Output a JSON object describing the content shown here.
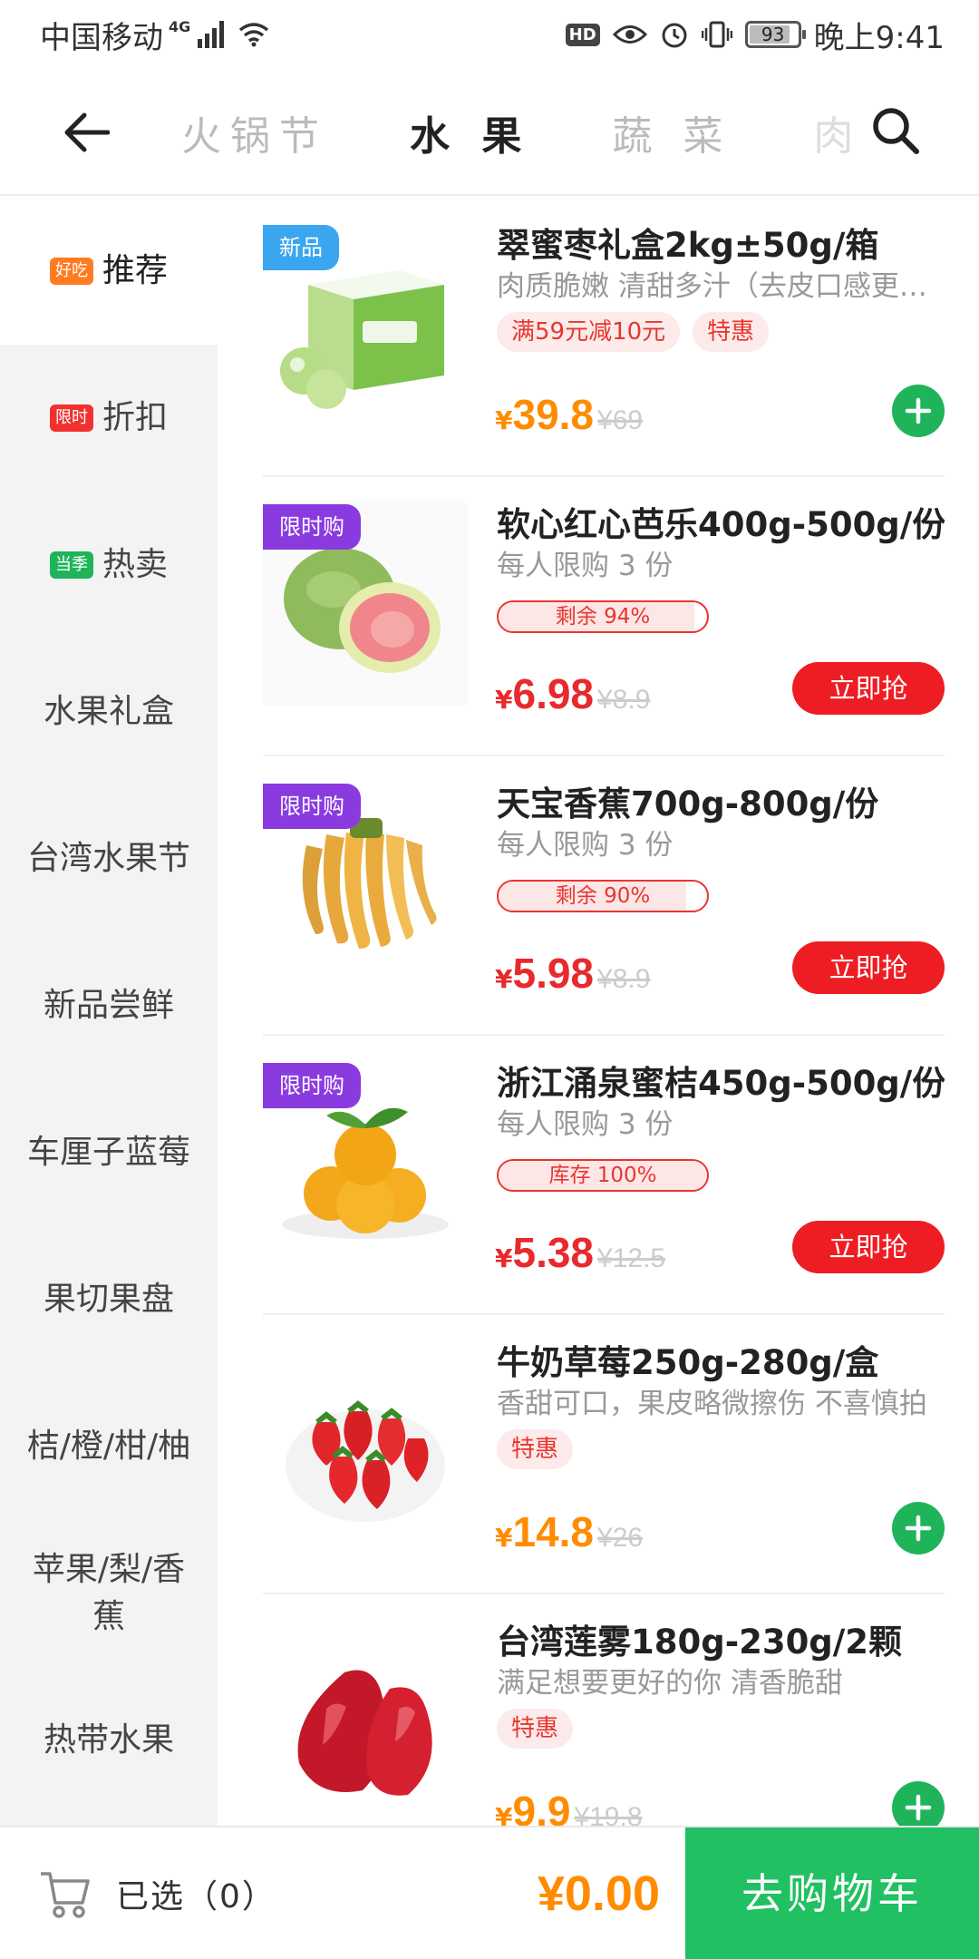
{
  "status_bar": {
    "carrier": "中国移动",
    "network": "4G",
    "battery": "93",
    "time": "晚上9:41"
  },
  "header": {
    "tabs": [
      {
        "label": "火锅节"
      },
      {
        "label": "水 果"
      },
      {
        "label": "蔬 菜"
      },
      {
        "label": "肉"
      }
    ],
    "active_tab": "水 果"
  },
  "sidebar": {
    "items": [
      {
        "tag": "好吃",
        "tag_color": "#ff7a21",
        "label": "推荐",
        "active": true
      },
      {
        "tag": "限时",
        "tag_color": "#f0312f",
        "label": "折扣"
      },
      {
        "tag": "当季",
        "tag_color": "#1fb45a",
        "label": "热卖"
      },
      {
        "label": "水果礼盒"
      },
      {
        "label": "台湾水果节"
      },
      {
        "label": "新品尝鲜"
      },
      {
        "label": "车厘子蓝莓"
      },
      {
        "label": "果切果盘"
      },
      {
        "label": "桔/橙/柑/柚"
      },
      {
        "label": "苹果/梨/香蕉"
      },
      {
        "label": "热带水果"
      }
    ]
  },
  "products": [
    {
      "name": "翠蜜枣礼盒2kg±50g/箱",
      "desc": "肉质脆嫩  清甜多汁（去皮口感更佳）",
      "badge": "新品",
      "tags": [
        "满59元减10元",
        "特惠"
      ],
      "yen": "¥",
      "price": "39.8",
      "old_price": "¥69",
      "action": "add"
    },
    {
      "name": "软心红心芭乐400g-500g/份",
      "desc": "每人限购 3 份",
      "badge": "限时购",
      "stock_label": "剩余 94%",
      "stock_fraction": 0.94,
      "yen": "¥",
      "price": "6.98",
      "old_price": "¥8.9",
      "action_label": "立即抢"
    },
    {
      "name": "天宝香蕉700g-800g/份",
      "desc": "每人限购 3 份",
      "badge": "限时购",
      "stock_label": "剩余 90%",
      "stock_fraction": 0.9,
      "yen": "¥",
      "price": "5.98",
      "old_price": "¥8.9",
      "action_label": "立即抢"
    },
    {
      "name": "浙江涌泉蜜桔450g-500g/份",
      "desc": "每人限购 3 份",
      "badge": "限时购",
      "stock_label": "库存 100%",
      "stock_fraction": 1.0,
      "yen": "¥",
      "price": "5.38",
      "old_price": "¥12.5",
      "action_label": "立即抢"
    },
    {
      "name": "牛奶草莓250g-280g/盒",
      "desc": "香甜可口，果皮略微擦伤 不喜慎拍",
      "tags": [
        "特惠"
      ],
      "yen": "¥",
      "price": "14.8",
      "old_price": "¥26",
      "action": "add"
    },
    {
      "name": "台湾莲雾180g-230g/2颗",
      "desc": "满足想要更好的你 清香脆甜",
      "tags": [
        "特惠"
      ],
      "yen": "¥",
      "price": "9.9",
      "old_price": "¥19.8",
      "action": "add"
    }
  ],
  "bottom_bar": {
    "selected_label": "已选（0）",
    "total": "¥0.00",
    "checkout_label": "去购物车"
  },
  "colors": {
    "accent_green": "#21c063",
    "price_orange": "#ff8c00",
    "price_red": "#e8292d",
    "badge_purple": "#8a3be0",
    "badge_blue": "#3aa6ef"
  }
}
